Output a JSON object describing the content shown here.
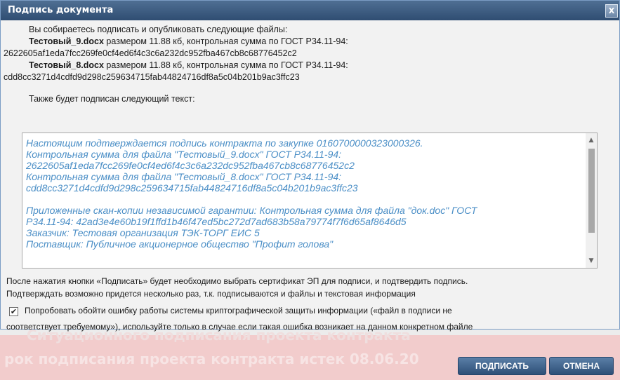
{
  "background": {
    "line1": "Ситуационного подписания проекта контракта",
    "line2": "рок подписания проекта контракта истек 08.06.20"
  },
  "dialog": {
    "title": "Подпись документа",
    "close_glyph": "X",
    "intro": "Вы собираетесь подписать и опубликовать следующие файлы:",
    "files": [
      {
        "name": "Тестовый_9.docx",
        "desc": " размером 11.88 кб, контрольная сумма по ГОСТ Р34.11-94:",
        "hash": "2622605af1eda7fcc269fe0cf4ed6f4c3c6a232dc952fba467cb8c68776452c2"
      },
      {
        "name": "Тестовый_8.docx",
        "desc": " размером 11.88 кб, контрольная сумма по ГОСТ Р34.11-94:",
        "hash": "cdd8cc3271d4cdfd9d298c259634715fab44824716df8a5c04b201b9ac3ffc23"
      }
    ],
    "also_signed": "Также будет подписан следующий текст:",
    "text_lines": [
      "Настоящим подтверждается подпись контракта по закупке 0160700000323000326.",
      "Контрольная сумма для файла \"Тестовый_9.docx\" ГОСТ Р34.11-94:",
      "2622605af1eda7fcc269fe0cf4ed6f4c3c6a232dc952fba467cb8c68776452c2",
      "Контрольная сумма для файла \"Тестовый_8.docx\" ГОСТ Р34.11-94:",
      "cdd8cc3271d4cdfd9d298c259634715fab44824716df8a5c04b201b9ac3ffc23",
      "",
      "Приложенные скан-копии независимой гарантии: Контрольная сумма для файла \"док.doc\" ГОСТ",
      "Р34.11-94: 42ad3e4e60b19f1ffd1b46f47ed5bc272d7ad683b58a79774f7f6d65af8646d5",
      "Заказчик: Тестовая организация ТЭК-ТОРГ ЕИС 5",
      "Поставщик: Публичное акционерное общество \"Профит голова\""
    ],
    "note_line1": "После нажатия кнопки «Подписать» будет необходимо выбрать сертификат ЭП для подписи, и подтвердить подпись.",
    "note_line2": "Подтверждать возможно придется несколько раз, т.к. подписываются и файлы и текстовая информация",
    "checkbox_checked": true,
    "checkbox_label_line1": "Попробовать обойти ошибку работы системы криптографической защиты информации («файл в подписи не",
    "checkbox_label_line2": "соответствует требуемому»), используйте только в случае если такая ошибка возникает на данном конкретном файле",
    "sign_label": "ПОДПИСАТЬ",
    "cancel_label": "ОТМЕНА"
  },
  "colors": {
    "titlebar": "#3a5a80",
    "text_area_text": "#4a8ec6",
    "button": "#3e638d"
  }
}
